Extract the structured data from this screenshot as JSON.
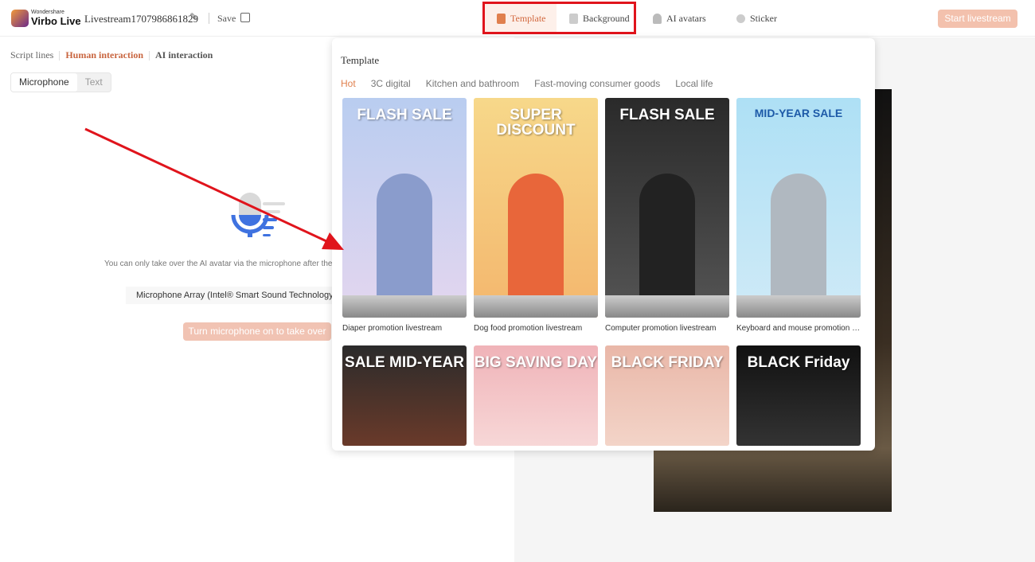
{
  "header": {
    "brand_small": "Wondershare",
    "brand": "Virbo Live",
    "title": "Livestream1707986861829",
    "save": "Save",
    "nav": [
      {
        "label": "Template",
        "icon": "template-icon",
        "active": true
      },
      {
        "label": "Background",
        "icon": "background-icon"
      },
      {
        "label": "AI avatars",
        "icon": "avatar-icon"
      },
      {
        "label": "Sticker",
        "icon": "sticker-icon"
      }
    ],
    "start": "Start livestream"
  },
  "left": {
    "tabs": [
      "Script lines",
      "Human interaction",
      "AI interaction"
    ],
    "active_tab": "Human interaction",
    "modes": [
      "Microphone",
      "Text"
    ],
    "active_mode": "Microphone",
    "hint": "You can only take over the AI avatar via the microphone after the",
    "device": "Microphone Array (Intel® Smart Sound Technology",
    "turn_on": "Turn microphone on to take over"
  },
  "popup": {
    "title": "Template",
    "categories": [
      "Hot",
      "3C digital",
      "Kitchen and bathroom",
      "Fast-moving consumer goods",
      "Local life"
    ],
    "active_category": "Hot",
    "templates": [
      {
        "name": "Diaper promotion livestream",
        "art": "FLASH SALE"
      },
      {
        "name": "Dog food promotion livestream",
        "art": "SUPER DISCOUNT"
      },
      {
        "name": "Computer promotion livestream",
        "art": "FLASH SALE"
      },
      {
        "name": "Keyboard and mouse promotion livestream",
        "art": "MID-YEAR SALE"
      },
      {
        "art": "SALE MID-YEAR"
      },
      {
        "art": "BIG SAVING DAY"
      },
      {
        "art": "BLACK FRIDAY"
      },
      {
        "art": "BLACK Friday"
      }
    ]
  },
  "colors": {
    "accent": "#d2693f",
    "highlight_box": "#e0141c",
    "arrow": "#e0141c"
  }
}
